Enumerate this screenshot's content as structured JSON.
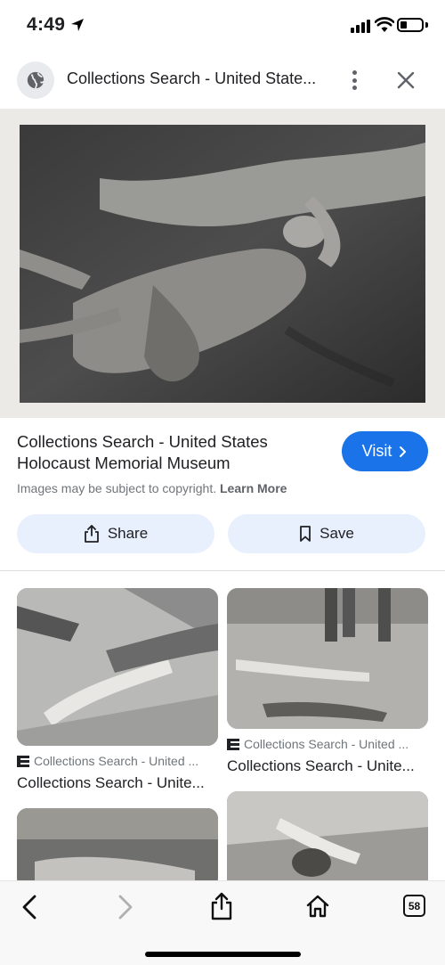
{
  "status_bar": {
    "time": "4:49"
  },
  "header": {
    "title": "Collections Search - United State...",
    "icons": [
      "globe-icon",
      "more-vert-icon",
      "close-icon"
    ]
  },
  "result": {
    "title": "Collections Search - United States Holocaust Memorial Museum",
    "visit_label": "Visit",
    "copyright_text": "Images may be subject to copyright.",
    "learn_more": "Learn More",
    "share_label": "Share",
    "save_label": "Save"
  },
  "related": [
    {
      "source": "Collections Search - United ...",
      "title": "Collections Search - Unite..."
    },
    {
      "source": "Collections Search - United ...",
      "title": "Collections Search - Unite..."
    }
  ],
  "bottom_bar": {
    "tab_count": "58",
    "icons": [
      "back-icon",
      "forward-icon",
      "share-icon",
      "home-icon",
      "tabs-icon"
    ]
  },
  "colors": {
    "accent": "#1a73e8",
    "pill_bg": "#e8f0fe",
    "secondary_text": "#70757a"
  }
}
